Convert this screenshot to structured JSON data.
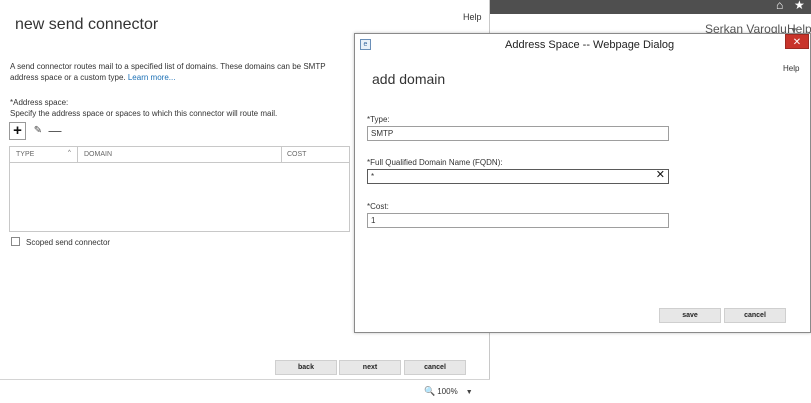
{
  "background": {
    "user_name": "Serkan Varoglu",
    "help_label": "Help",
    "home_icon": "home-icon",
    "star_icon": "star-icon"
  },
  "main": {
    "title": "new send connector",
    "help_label": "Help",
    "description": "A send connector routes mail to a specified list of domains. These domains can be SMTP address space or a custom type.",
    "learn_more": "Learn more...",
    "address_space_label": "*Address space:",
    "address_space_hint": "Specify the address space or spaces to which this connector will route mail.",
    "toolbar": {
      "add_glyph": "+",
      "edit_glyph": "✎",
      "remove_glyph": "—"
    },
    "table": {
      "columns": [
        "TYPE",
        "DOMAIN",
        "COST"
      ],
      "rows": []
    },
    "scoped_label": "Scoped send connector",
    "scoped_checked": false,
    "buttons": {
      "back": "back",
      "next": "next",
      "cancel": "cancel"
    },
    "zoom": "100%"
  },
  "dialog": {
    "window_title": "Address Space -- Webpage Dialog",
    "close_glyph": "✕",
    "help_label": "Help",
    "heading": "add domain",
    "type_label": "*Type:",
    "type_value": "SMTP",
    "fqdn_label": "*Full Qualified Domain Name (FQDN):",
    "fqdn_value": "*",
    "cost_label": "*Cost:",
    "cost_value": "1",
    "buttons": {
      "save": "save",
      "cancel": "cancel"
    }
  },
  "colors": {
    "close_button": "#c8342b",
    "link": "#1a6fb5",
    "button_bg": "#e7e7e7"
  }
}
